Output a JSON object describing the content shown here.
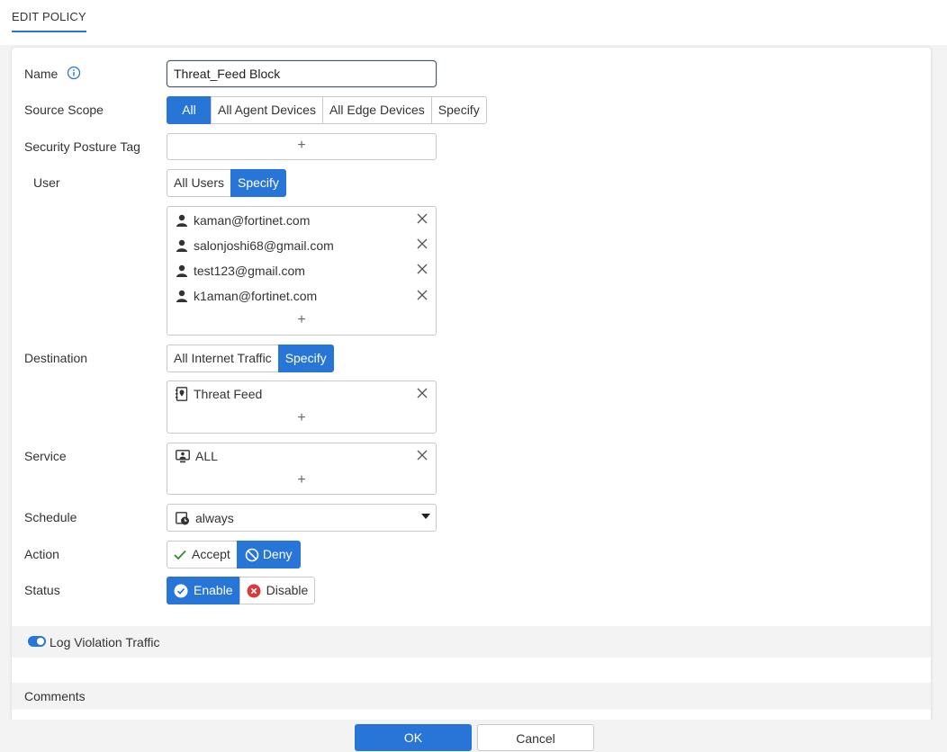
{
  "tab": {
    "title": "EDIT POLICY"
  },
  "form": {
    "name": {
      "label": "Name",
      "value": "Threat_Feed Block"
    },
    "source_scope": {
      "label": "Source Scope",
      "options": [
        "All",
        "All Agent Devices",
        "All Edge Devices",
        "Specify"
      ],
      "selected": "All"
    },
    "security_posture_tag": {
      "label": "Security Posture Tag",
      "add": "+"
    },
    "user": {
      "label": "User",
      "options": [
        "All Users",
        "Specify"
      ],
      "selected": "Specify",
      "entries": [
        "kaman@fortinet.com",
        "salonjoshi68@gmail.com",
        "test123@gmail.com",
        "k1aman@fortinet.com"
      ],
      "add": "+"
    },
    "destination": {
      "label": "Destination",
      "options": [
        "All Internet Traffic",
        "Specify"
      ],
      "selected": "Specify",
      "entries": [
        "Threat Feed"
      ],
      "add": "+"
    },
    "service": {
      "label": "Service",
      "entries": [
        "ALL"
      ],
      "add": "+"
    },
    "schedule": {
      "label": "Schedule",
      "value": "always"
    },
    "action": {
      "label": "Action",
      "options": [
        "Accept",
        "Deny"
      ],
      "selected": "Deny"
    },
    "status": {
      "label": "Status",
      "options": [
        "Enable",
        "Disable"
      ],
      "selected": "Enable"
    },
    "log_violation": {
      "label": "Log Violation Traffic",
      "enabled": true
    },
    "comments": {
      "label": "Comments"
    }
  },
  "footer": {
    "ok": "OK",
    "cancel": "Cancel"
  },
  "colors": {
    "accent": "#2875d8",
    "accept_check": "#2e8b2e",
    "disable_red": "#d93a3a"
  }
}
